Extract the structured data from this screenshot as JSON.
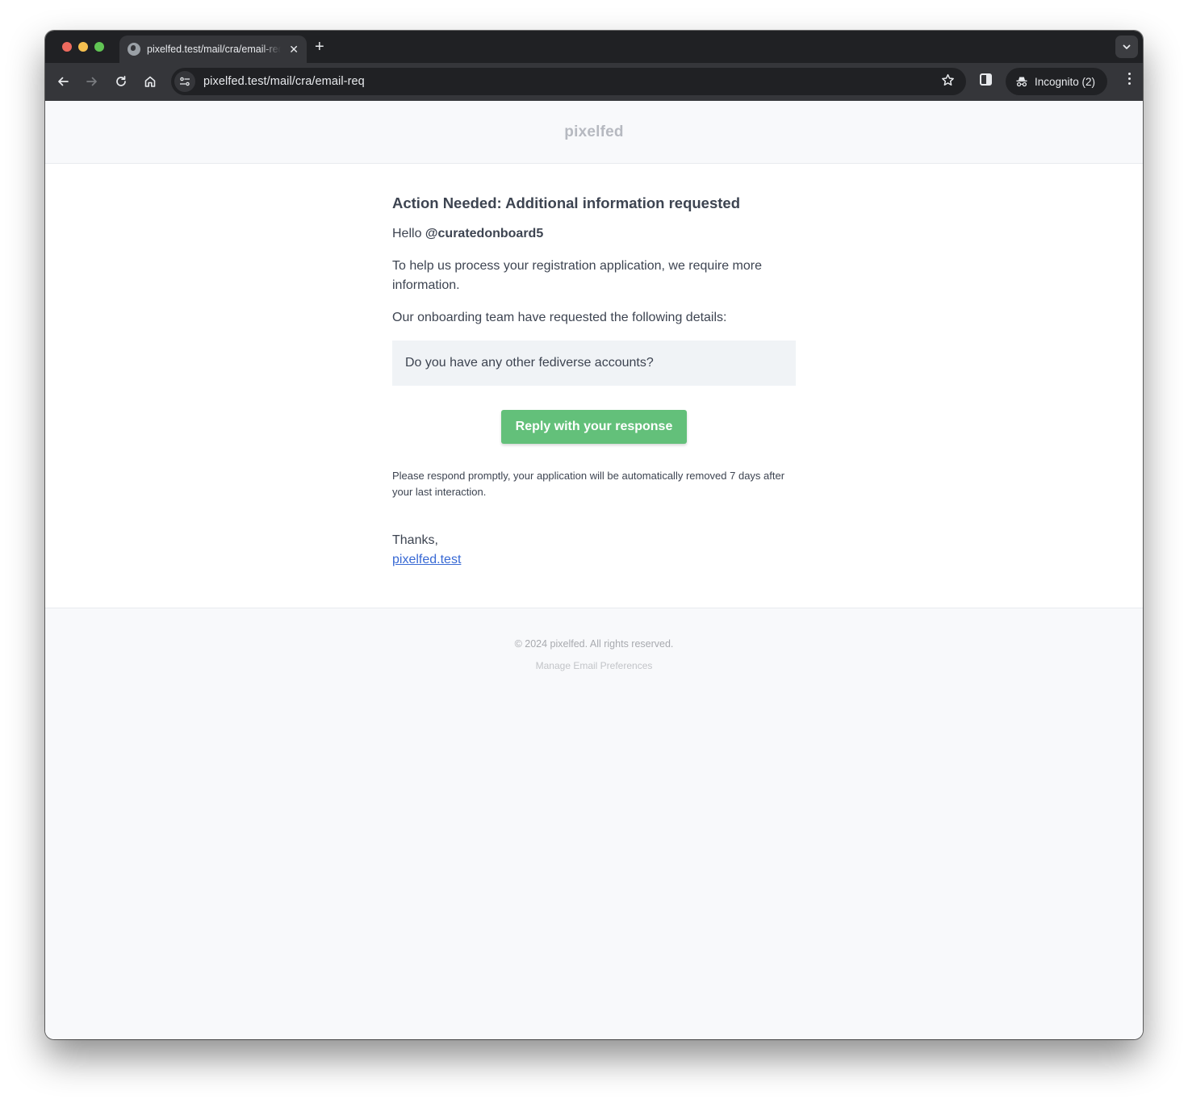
{
  "browser": {
    "tab": {
      "title": "pixelfed.test/mail/cra/email-req",
      "icon": "globe-icon"
    },
    "new_tab_label": "+",
    "close_tab_label": "✕",
    "address_bar": {
      "url": "pixelfed.test/mail/cra/email-req"
    },
    "profile": {
      "label": "Incognito (2)"
    },
    "nav": {
      "back": "←",
      "forward": "→",
      "reload": "↻",
      "home": "⌂",
      "bookmark": "☆",
      "tab_search": "⌄"
    }
  },
  "email": {
    "brand": "pixelfed",
    "heading": "Action Needed: Additional information requested",
    "greeting": "Hello",
    "username": "@curatedonboard5",
    "intro": "To help us process your registration application, we require more information.",
    "details_intro": "Our onboarding team have requested the following details:",
    "request_question": "Do you have any other fediverse accounts?",
    "reply_button": "Reply with your response",
    "note": "Please respond promptly, your application will be automatically removed 7 days after your last interaction.",
    "sign_off": "Thanks,",
    "site_link": "pixelfed.test"
  },
  "footer": {
    "copyright": "© 2024 pixelfed. All rights reserved.",
    "manage_prefs": "Manage Email Preferences"
  },
  "colors": {
    "button_green": "#63c07a",
    "link_blue": "#3869d4",
    "text": "#3d4451",
    "panel_bg": "#f0f3f6"
  }
}
